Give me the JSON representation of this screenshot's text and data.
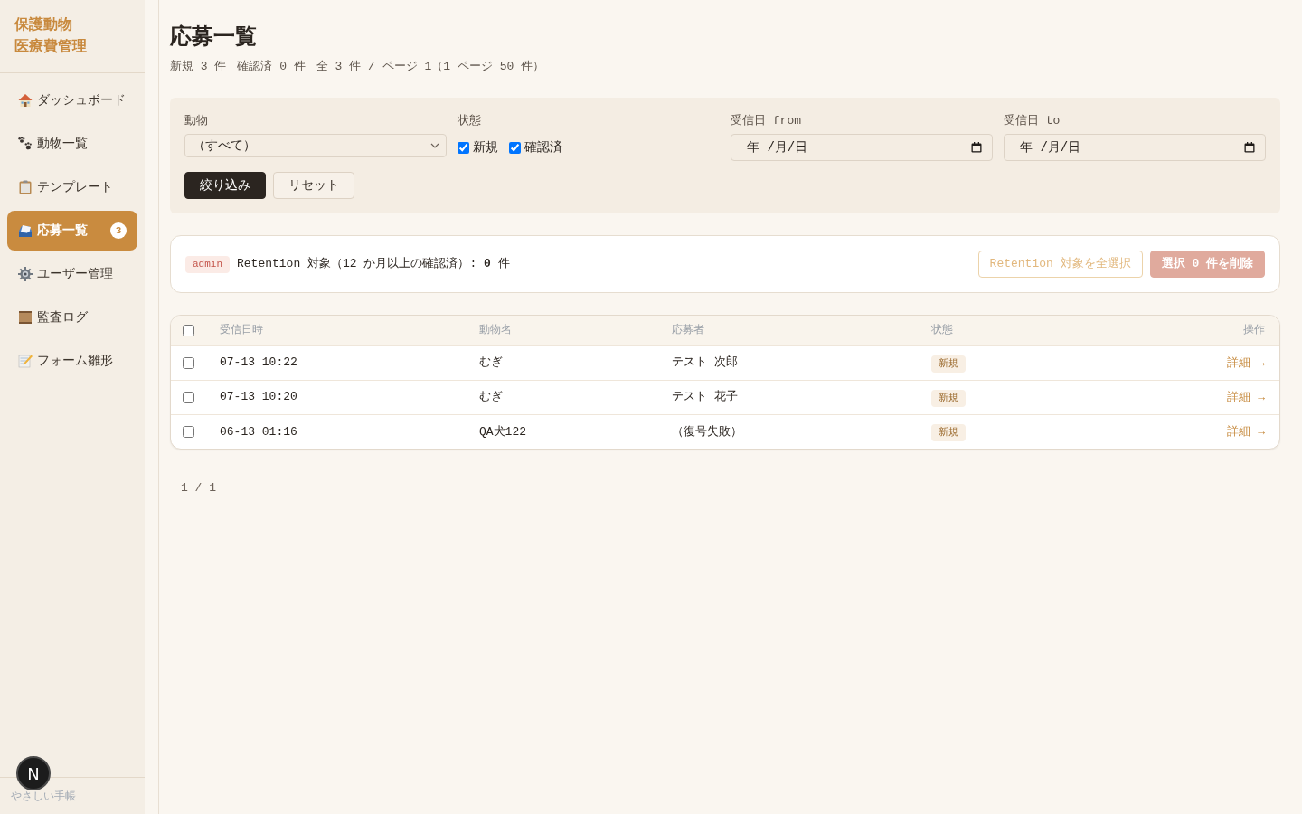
{
  "sidebar": {
    "title": [
      "保護動物",
      "医療費管理"
    ],
    "items": [
      {
        "label": "ダッシュボード",
        "selected": false
      },
      {
        "label": "動物一覧",
        "selected": false
      },
      {
        "label": "テンプレート",
        "selected": false
      },
      {
        "label": "応募一覧",
        "selected": true,
        "badge": "3"
      },
      {
        "label": "ユーザー管理",
        "selected": false
      },
      {
        "label": "監査ログ",
        "selected": false
      },
      {
        "label": "フォーム雛形",
        "selected": false
      }
    ],
    "footer": "やさしい手帳"
  },
  "dev_indicator": {
    "label": "N"
  },
  "page": {
    "title": "応募一覧",
    "summary": [
      "新規 3 件",
      "確認済 0 件",
      "全 3 件 / ページ 1（1 ページ 50 件）"
    ]
  },
  "filters": {
    "animal": {
      "label": "動物",
      "value": "（すべて）"
    },
    "status": {
      "label": "状態",
      "options": [
        {
          "label": "新規",
          "checked": true
        },
        {
          "label": "確認済",
          "checked": true
        }
      ]
    },
    "date_from": {
      "label": "受信日 from",
      "placeholder": "年 /月/日"
    },
    "date_to": {
      "label": "受信日 to",
      "placeholder": "年 /月/日"
    },
    "buttons": [
      {
        "label": "絞り込み",
        "kind": "primary"
      },
      {
        "label": "リセット",
        "kind": "secondary"
      }
    ]
  },
  "retention": {
    "role_badge": "admin",
    "text": "Retention 対象（12 か月以上の確認済）: **0** 件",
    "buttons": [
      {
        "label": "Retention 対象を全選択",
        "kind": "outline",
        "disabled": true
      },
      {
        "label": "選択 0 件を削除",
        "kind": "danger",
        "disabled": true
      }
    ]
  },
  "table": {
    "select_all": {
      "checked": false
    },
    "columns": [
      "受信日時",
      "動物名",
      "応募者",
      "状態",
      "操作"
    ],
    "rows": [
      {
        "checked": false,
        "received": "07-13 10:22",
        "animal": "むぎ",
        "applicant": "テスト 次郎",
        "status": "新規",
        "action": "詳細 →"
      },
      {
        "checked": false,
        "received": "07-13 10:20",
        "animal": "むぎ",
        "applicant": "テスト 花子",
        "status": "新規",
        "action": "詳細 →"
      },
      {
        "checked": false,
        "received": "06-13 01:16",
        "animal": "QA犬122",
        "applicant": "（復号失敗）",
        "status": "新規",
        "action": "詳細 →"
      }
    ]
  },
  "pagination": "1 / 1"
}
